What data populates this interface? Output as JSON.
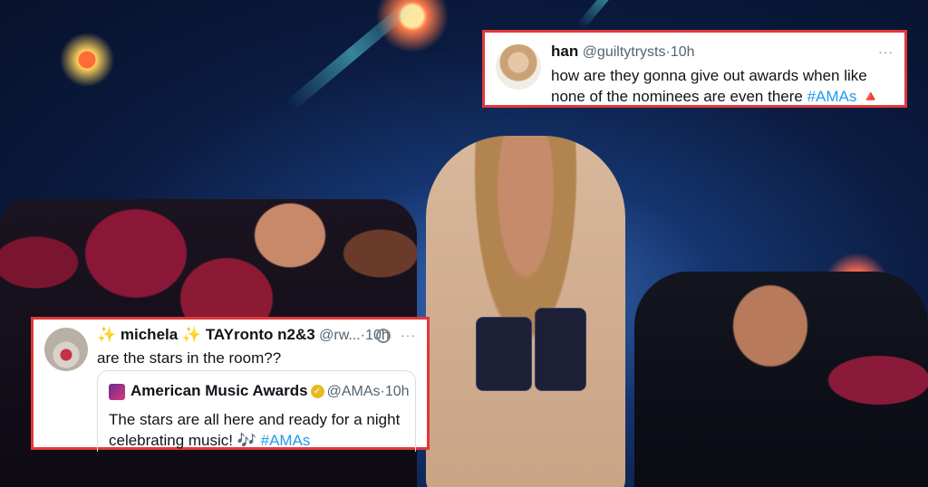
{
  "tweet_top": {
    "name": "han",
    "handle": "@guiltytrysts",
    "sep": "·",
    "time": "10h",
    "more": "···",
    "text": "how are they gonna give out awards when like none of the nominees are even there ",
    "hashtag": "#AMAs",
    "emoji": "🔺"
  },
  "tweet_bottom": {
    "name": "✨ michela ✨ TAYronto n2&3",
    "handle": "@rw...",
    "sep": "·",
    "time": "10h",
    "more": "···",
    "text": "are the stars in the room??",
    "quote": {
      "name": "American Music Awards",
      "handle": "@AMAs",
      "sep": "·",
      "time": "10h",
      "text_line1": "The stars are all here and ready for a night",
      "text_line2": "celebrating music! 🎶 ",
      "hashtag": "#AMAs"
    }
  },
  "colors": {
    "border_red": "#e0393a",
    "hashtag_blue": "#1d9bf0",
    "verified_gold": "#e9b923"
  }
}
